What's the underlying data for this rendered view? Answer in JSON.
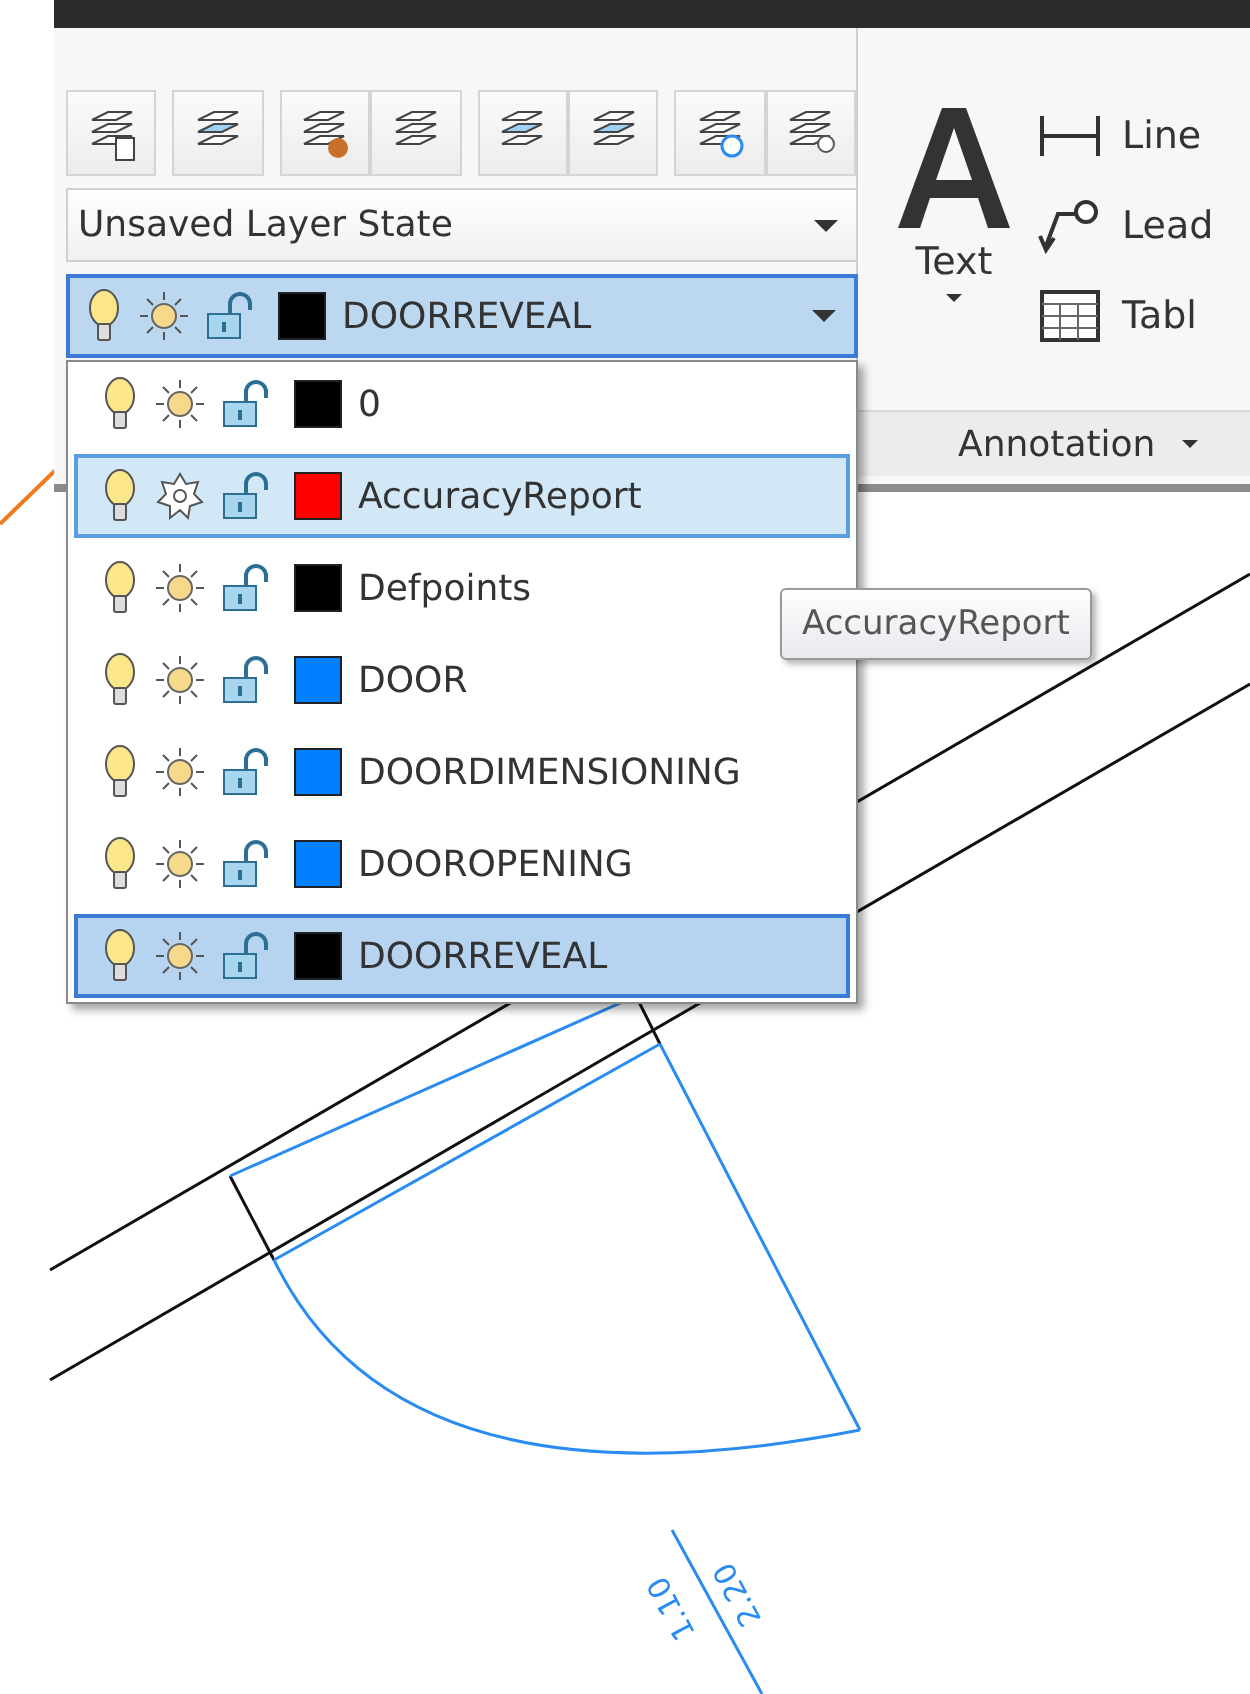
{
  "layer_state": {
    "value": "Unsaved Layer State"
  },
  "current_layer": {
    "name": "DOORREVEAL",
    "color": "#000000"
  },
  "layers": [
    {
      "name": "0",
      "color": "#000000",
      "frozen": false,
      "hovered": false,
      "selected": false
    },
    {
      "name": "AccuracyReport",
      "color": "#ff0000",
      "frozen": true,
      "hovered": true,
      "selected": false
    },
    {
      "name": "Defpoints",
      "color": "#000000",
      "frozen": false,
      "hovered": false,
      "selected": false
    },
    {
      "name": "DOOR",
      "color": "#0080ff",
      "frozen": false,
      "hovered": false,
      "selected": false
    },
    {
      "name": "DOORDIMENSIONING",
      "color": "#0080ff",
      "frozen": false,
      "hovered": false,
      "selected": false
    },
    {
      "name": "DOOROPENING",
      "color": "#0080ff",
      "frozen": false,
      "hovered": false,
      "selected": false
    },
    {
      "name": "DOORREVEAL",
      "color": "#000000",
      "frozen": false,
      "hovered": false,
      "selected": true
    }
  ],
  "tooltip": "AccuracyReport",
  "annotation": {
    "text_tool": "Text",
    "tools": [
      {
        "kind": "linear",
        "label": "Line"
      },
      {
        "kind": "leader",
        "label": "Lead"
      },
      {
        "kind": "table",
        "label": "Tabl"
      }
    ],
    "panel_title": "Annotation"
  },
  "drawing": {
    "dimension_texts": [
      "1.10",
      "2.20"
    ]
  }
}
